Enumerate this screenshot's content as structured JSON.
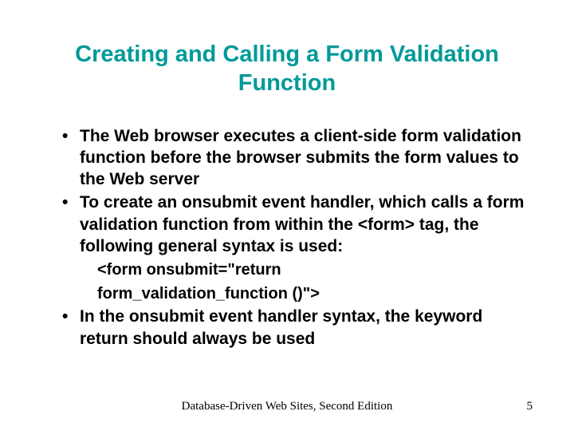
{
  "title": "Creating and Calling a Form Validation Function",
  "bullets": [
    "The Web browser executes a client-side form validation function before the browser submits the form values to the Web server",
    "To create an onsubmit event handler, which calls a form validation function from within the <form> tag, the following general syntax is used:",
    "In the onsubmit event handler syntax, the keyword return should always be used"
  ],
  "code_line1": "<form onsubmit=\"return",
  "code_line2": "form_validation_function  ()\">",
  "footer": "Database-Driven Web Sites, Second Edition",
  "page": "5"
}
